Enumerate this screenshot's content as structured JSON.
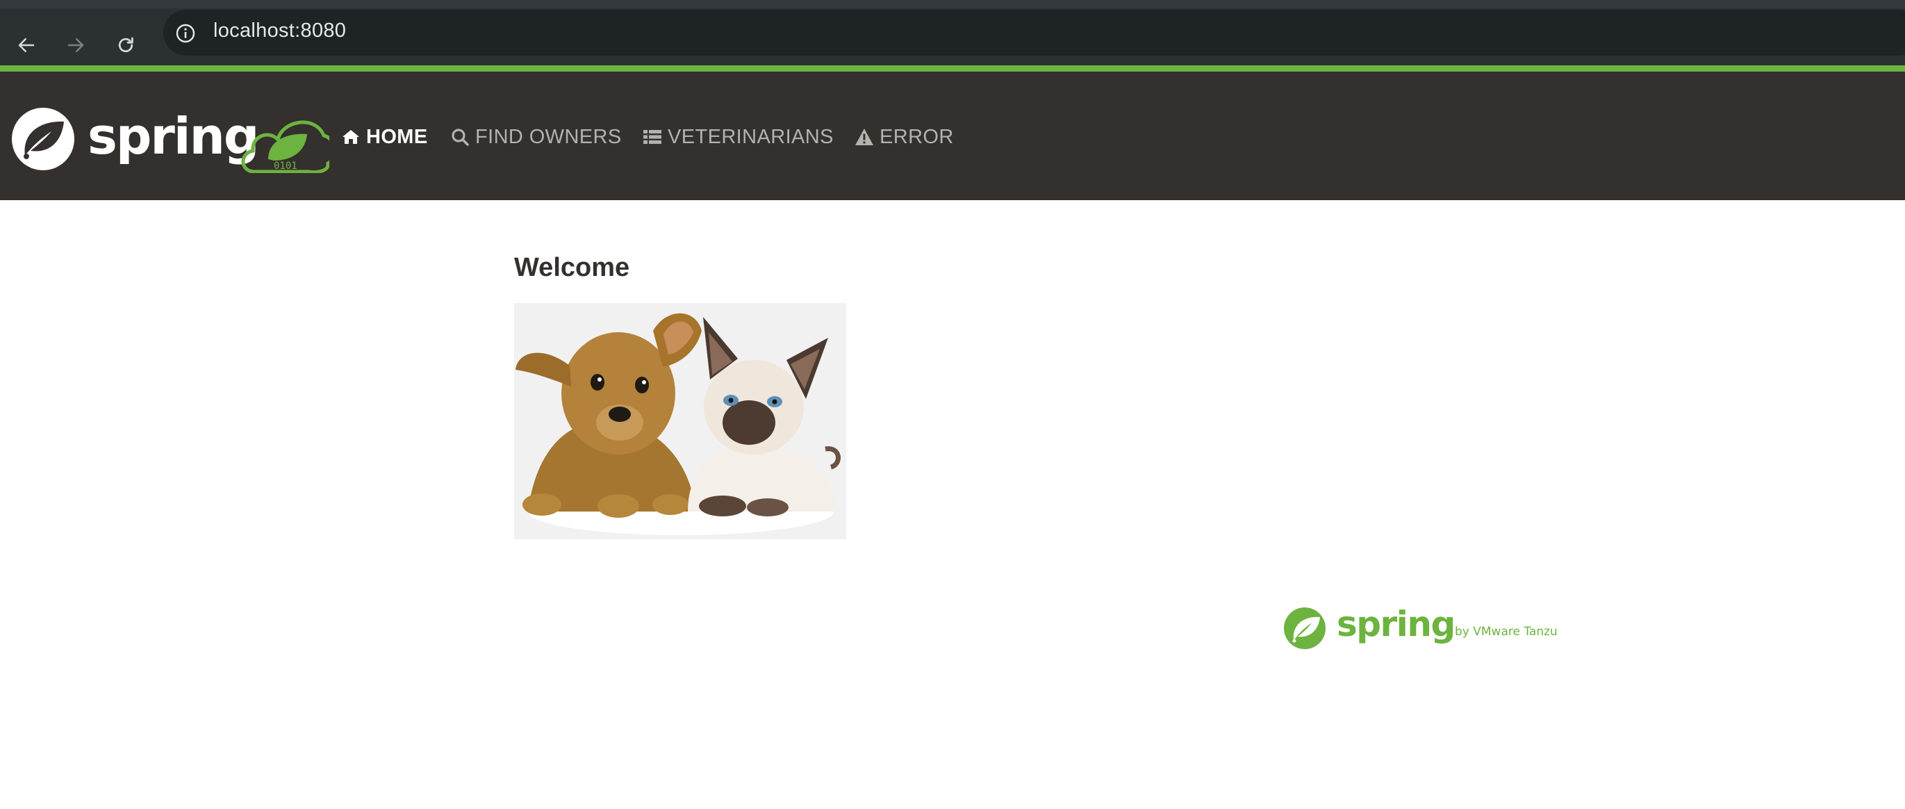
{
  "browser": {
    "url": "localhost:8080",
    "back_icon": "arrow-left-icon",
    "forward_icon": "arrow-right-icon",
    "reload_icon": "reload-icon",
    "site_info_icon": "info-circle-icon"
  },
  "navbar": {
    "accent_color": "#6db33f",
    "background_color": "#34302d",
    "brand_icon": "spring-logo-icon",
    "items": [
      {
        "label": "HOME",
        "icon": "home-icon",
        "active": true
      },
      {
        "label": "FIND OWNERS",
        "icon": "search-icon",
        "active": false
      },
      {
        "label": "VETERINARIANS",
        "icon": "list-icon",
        "active": false
      },
      {
        "label": "ERROR",
        "icon": "warning-icon",
        "active": false
      }
    ]
  },
  "main": {
    "heading": "Welcome",
    "image_icon": "pets-image"
  },
  "footer": {
    "logo_icon": "spring-by-vmware-tanzu-logo-icon"
  }
}
